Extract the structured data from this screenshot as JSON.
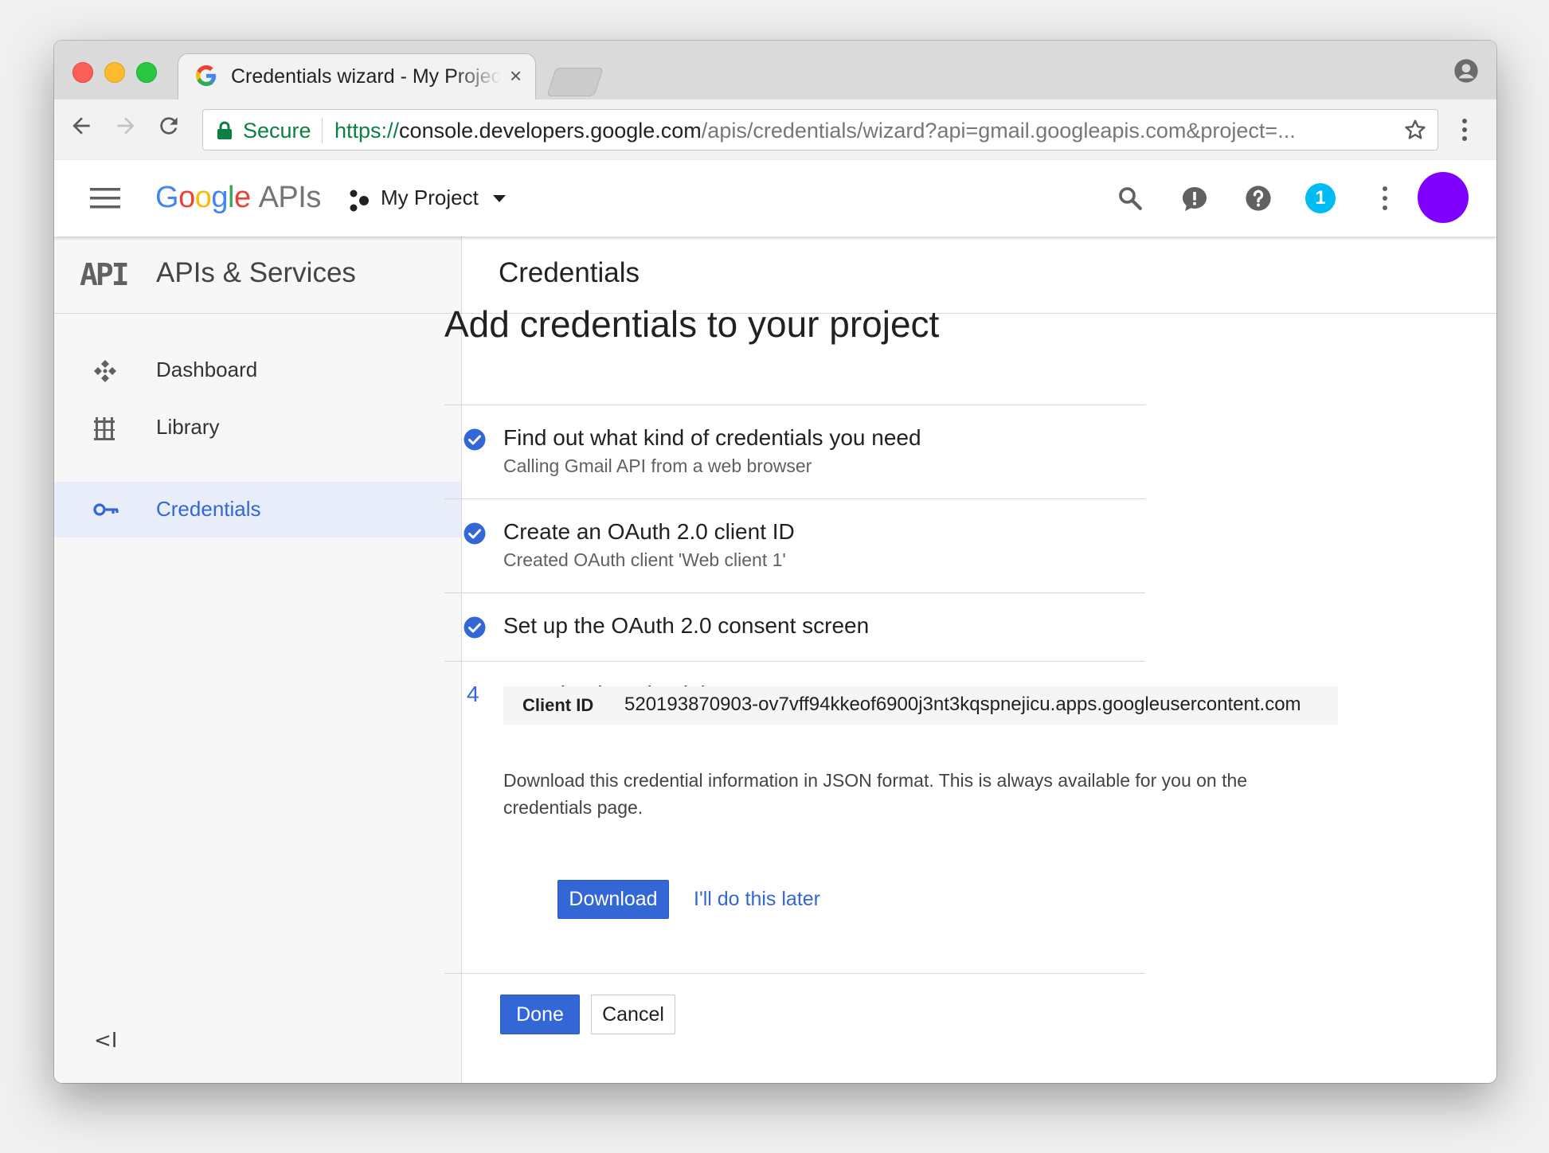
{
  "browser": {
    "tab_title": "Credentials wizard - My Project",
    "tab_close": "×",
    "secure_label": "Secure",
    "url_scheme": "https://",
    "url_host": "console.developers.google.com",
    "url_path": "/apis/credentials/wizard?api=gmail.googleapis.com&project=..."
  },
  "appbar": {
    "logo_google": "Google",
    "logo_apis": "APIs",
    "project_name": "My Project",
    "notification_count": "1",
    "avatar_color": "#8000ff"
  },
  "sidebar": {
    "logo": "API",
    "title": "APIs & Services",
    "items": [
      {
        "label": "Dashboard",
        "icon": "dashboard-icon",
        "active": false
      },
      {
        "label": "Library",
        "icon": "library-icon",
        "active": false
      },
      {
        "label": "Credentials",
        "icon": "key-icon",
        "active": true
      }
    ],
    "collapse_label": "<I"
  },
  "main": {
    "header_title": "Credentials",
    "heading": "Add credentials to your project",
    "steps": [
      {
        "title": "Find out what kind of credentials you need",
        "subtitle": "Calling Gmail API from a web browser",
        "status": "complete"
      },
      {
        "title": "Create an OAuth 2.0 client ID",
        "subtitle": "Created OAuth client 'Web client 1'",
        "status": "complete"
      },
      {
        "title": "Set up the OAuth 2.0 consent screen",
        "subtitle": "",
        "status": "complete"
      },
      {
        "title": "Download credentials",
        "number": "4",
        "status": "current"
      }
    ],
    "client_id_label": "Client ID",
    "client_id_value": "520193870903-ov7vff94kkeof6900j3nt3kqspnejicu.apps.googleusercontent.com",
    "download_description": "Download this credential information in JSON format. This is always available for you on the credentials page.",
    "download_button": "Download",
    "later_link": "I'll do this later",
    "done_button": "Done",
    "cancel_button": "Cancel"
  },
  "colors": {
    "accent": "#3367d6",
    "secure_green": "#0b8043",
    "badge": "#00bcf2"
  }
}
